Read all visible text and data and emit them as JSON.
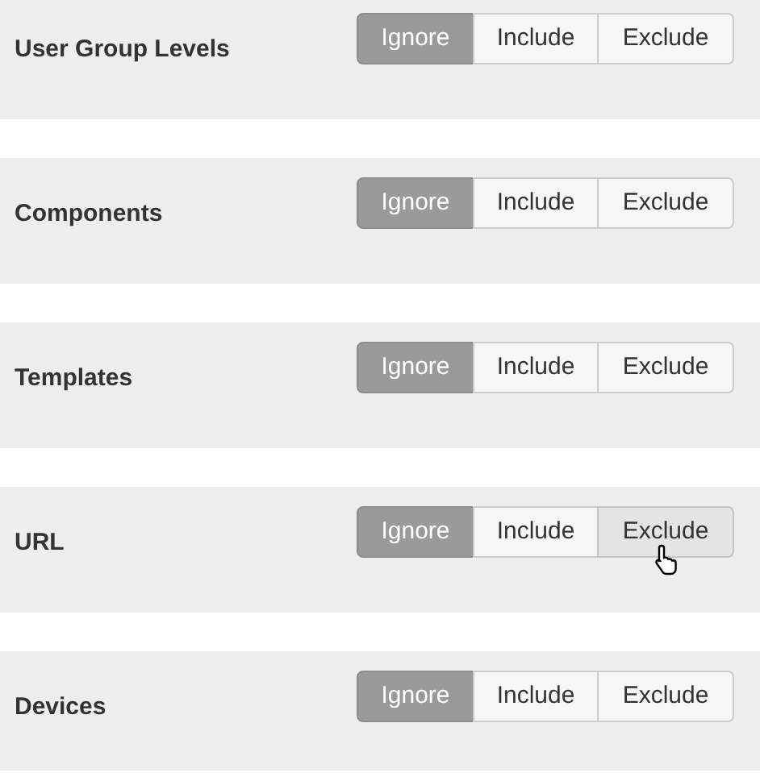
{
  "filters": [
    {
      "label": "User Group Levels",
      "options": [
        {
          "label": "Ignore",
          "selected": true,
          "hovered": false
        },
        {
          "label": "Include",
          "selected": false,
          "hovered": false
        },
        {
          "label": "Exclude",
          "selected": false,
          "hovered": false
        }
      ]
    },
    {
      "label": "Components",
      "options": [
        {
          "label": "Ignore",
          "selected": true,
          "hovered": false
        },
        {
          "label": "Include",
          "selected": false,
          "hovered": false
        },
        {
          "label": "Exclude",
          "selected": false,
          "hovered": false
        }
      ]
    },
    {
      "label": "Templates",
      "options": [
        {
          "label": "Ignore",
          "selected": true,
          "hovered": false
        },
        {
          "label": "Include",
          "selected": false,
          "hovered": false
        },
        {
          "label": "Exclude",
          "selected": false,
          "hovered": false
        }
      ]
    },
    {
      "label": "URL",
      "options": [
        {
          "label": "Ignore",
          "selected": true,
          "hovered": false
        },
        {
          "label": "Include",
          "selected": false,
          "hovered": false
        },
        {
          "label": "Exclude",
          "selected": false,
          "hovered": true
        }
      ]
    },
    {
      "label": "Devices",
      "options": [
        {
          "label": "Ignore",
          "selected": true,
          "hovered": false
        },
        {
          "label": "Include",
          "selected": false,
          "hovered": false
        },
        {
          "label": "Exclude",
          "selected": false,
          "hovered": false
        }
      ]
    }
  ]
}
